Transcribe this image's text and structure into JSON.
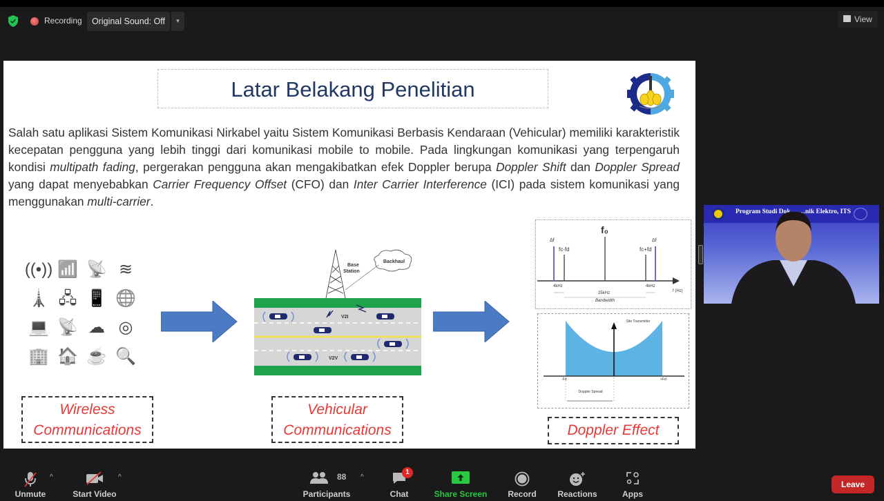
{
  "topbar": {
    "security_icon": "shield-check-icon",
    "recording_label": "Recording",
    "original_sound_label": "Original Sound: Off",
    "view_label": "View"
  },
  "slide": {
    "title": "Latar Belakang Penelitian",
    "paragraph": [
      {
        "text": "Salah satu aplikasi Sistem Komunikasi Nirkabel yaitu Sistem Komunikasi Berbasis Kendaraan (Vehicular) memiliki karakteristik kecepatan pengguna yang lebih tinggi dari komunikasi mobile to mobile. Pada lingkungan komunikasi yang terpengaruh kondisi ",
        "italic": false
      },
      {
        "text": "multipath fading",
        "italic": true
      },
      {
        "text": ", pergerakan pengguna akan mengakibatkan efek Doppler berupa ",
        "italic": false
      },
      {
        "text": "Doppler Shift",
        "italic": true
      },
      {
        "text": " dan ",
        "italic": false
      },
      {
        "text": "Doppler Spread",
        "italic": true
      },
      {
        "text": " yang dapat menyebabkan ",
        "italic": false
      },
      {
        "text": "Carrier Frequency Offset",
        "italic": true
      },
      {
        "text": " (CFO) dan ",
        "italic": false
      },
      {
        "text": "Inter Carrier Interference",
        "italic": true
      },
      {
        "text": " (ICI) pada sistem komunikasi yang menggunakan ",
        "italic": false
      },
      {
        "text": "multi-carrier",
        "italic": true
      },
      {
        "text": ".",
        "italic": false
      }
    ],
    "wireless_icons": [
      "((•))",
      "📶",
      "📡",
      "≋",
      "🗼",
      "🖧",
      "📱",
      "🌐",
      "💻",
      "📡",
      "☁",
      "◎",
      "🏢",
      "🏠",
      "☕",
      "🔍"
    ],
    "vehicular": {
      "base_station": "Base Station",
      "backhaul": "Backhaul",
      "v2i": "V2I",
      "v2v": "V2V"
    },
    "spectrum": {
      "f0": "f₀",
      "delta_f": "Δf",
      "fc_minus": "fc-fd",
      "fc_plus": "fc+fd",
      "left_gap": "4kHz",
      "right_gap": "4kHz",
      "bandwidth_value": "25kHz",
      "bandwidth_label": "Bandwidth",
      "axis_label": "f (Hz)"
    },
    "doppler": {
      "site_label": "Site Transmitter",
      "minus_fd": "-Fd",
      "plus_fd": "+Fd",
      "spread_label": "Doppler Spread"
    },
    "captions": {
      "wireless_1": "Wireless",
      "wireless_2": "Communications",
      "vehicular_1": "Vehicular",
      "vehicular_2": "Communications",
      "doppler": "Doppler Effect"
    }
  },
  "self_view": {
    "banner": "Program Studi Dok… …nik Elektro, ITS"
  },
  "toolbar": {
    "unmute": "Unmute",
    "start_video": "Start Video",
    "participants": "Participants",
    "participant_count": "88",
    "chat": "Chat",
    "chat_badge": "1",
    "share_screen": "Share Screen",
    "record": "Record",
    "reactions": "Reactions",
    "apps": "Apps",
    "leave": "Leave"
  },
  "colors": {
    "share_green": "#28c840",
    "leave_red": "#c42727",
    "caption_red": "#e53935",
    "title_navy": "#1f3864",
    "spectrum_blue": "#5db3e4"
  }
}
